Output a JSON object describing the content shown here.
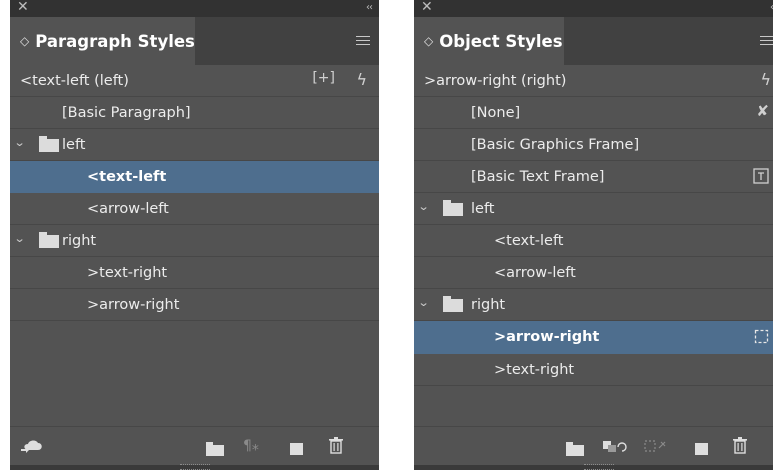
{
  "paragraph_panel": {
    "tab_title": "Paragraph Styles",
    "current_style": "<text-left (left)",
    "items": [
      {
        "label": "[Basic Paragraph]"
      },
      {
        "label": "left"
      },
      {
        "label": "<text-left"
      },
      {
        "label": "<arrow-left"
      },
      {
        "label": "right"
      },
      {
        "label": ">text-right"
      },
      {
        "label": ">arrow-right"
      }
    ]
  },
  "object_panel": {
    "tab_title": "Object Styles",
    "current_style": ">arrow-right (right)",
    "items": [
      {
        "label": "[None]"
      },
      {
        "label": "[Basic Graphics Frame]"
      },
      {
        "label": "[Basic Text Frame]"
      },
      {
        "label": "left"
      },
      {
        "label": "<text-left"
      },
      {
        "label": "<arrow-left"
      },
      {
        "label": "right"
      },
      {
        "label": ">arrow-right"
      },
      {
        "label": ">text-right"
      }
    ]
  },
  "colors": {
    "panel_bg": "#535353",
    "selected_row": "#4e6e8e",
    "titlebar": "#323232"
  }
}
